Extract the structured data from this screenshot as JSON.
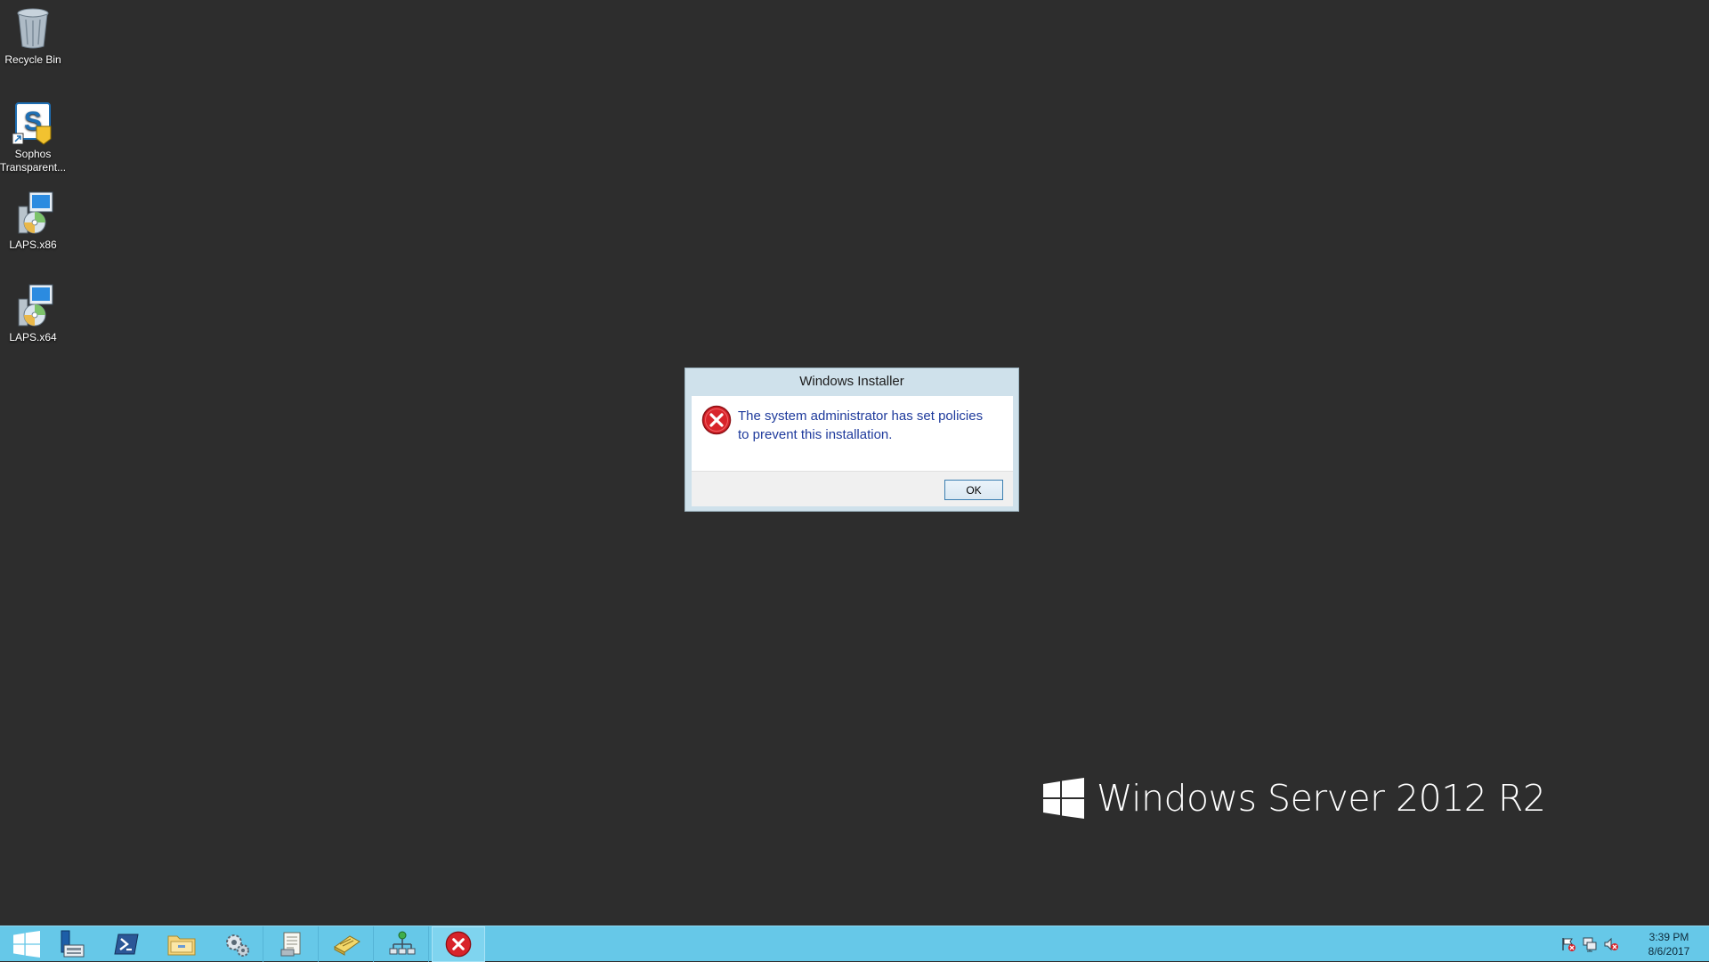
{
  "desktop": {
    "icons": [
      {
        "label": "Recycle Bin",
        "icon": "recycle-bin-icon"
      },
      {
        "label": "Sophos Transparent...",
        "icon": "sophos-icon"
      },
      {
        "label": "LAPS.x86",
        "icon": "installer-icon"
      },
      {
        "label": "LAPS.x64",
        "icon": "installer-icon"
      }
    ],
    "branding": "Windows Server 2012 R2"
  },
  "dialog": {
    "title": "Windows Installer",
    "message_line1": "The system administrator has set policies",
    "message_line2": "to prevent this installation.",
    "ok_label": "OK",
    "icon": "error-icon"
  },
  "taskbar": {
    "buttons": [
      {
        "name": "start",
        "icon": "windows-logo-icon"
      },
      {
        "name": "server-manager",
        "icon": "server-manager-icon"
      },
      {
        "name": "powershell",
        "icon": "powershell-icon"
      },
      {
        "name": "file-explorer",
        "icon": "folder-icon"
      },
      {
        "name": "settings",
        "icon": "gear-icon"
      },
      {
        "name": "notepad",
        "icon": "notepad-icon"
      },
      {
        "name": "mail",
        "icon": "envelope-icon"
      },
      {
        "name": "network",
        "icon": "network-icon"
      },
      {
        "name": "windows-installer",
        "icon": "error-icon"
      }
    ],
    "tray": {
      "icons": [
        "flag-error-icon",
        "network-status-icon",
        "volume-muted-icon"
      ],
      "time": "3:39 PM",
      "date": "8/6/2017"
    }
  },
  "colors": {
    "desktop_bg": "#2d2d2d",
    "taskbar_bg": "#66c8e8",
    "dialog_frame": "#cfe1eb",
    "message_text": "#1e3a9c",
    "error_red": "#d8232a"
  }
}
